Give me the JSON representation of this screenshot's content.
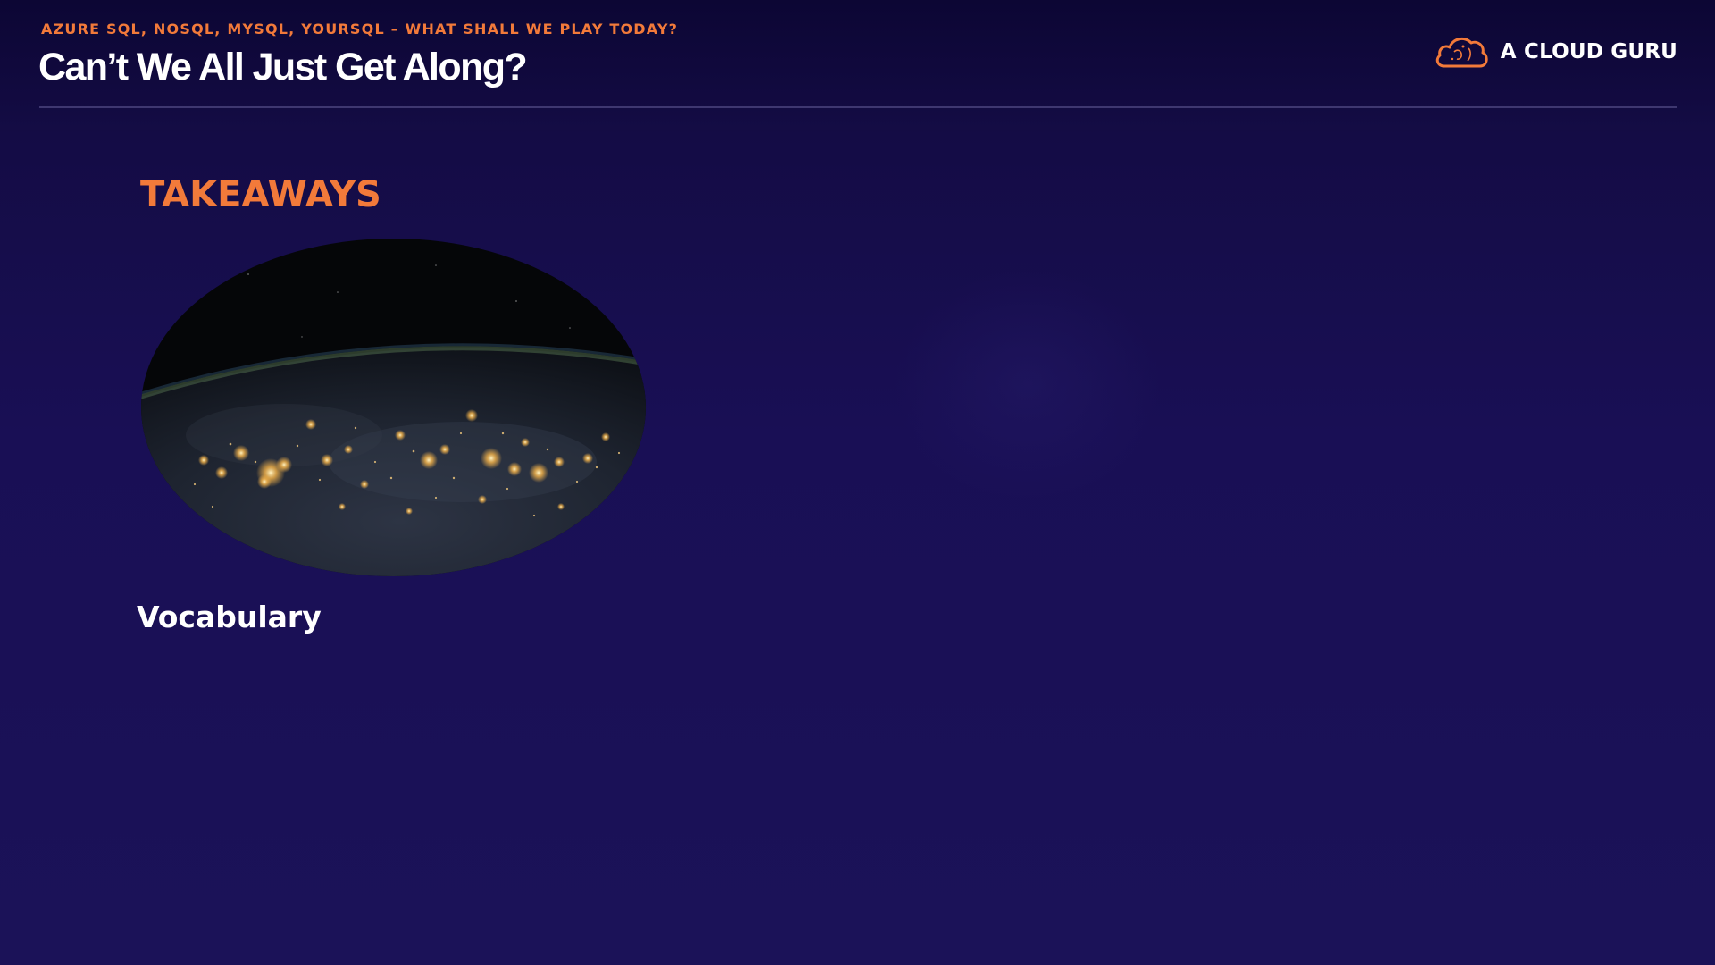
{
  "header": {
    "eyebrow": "AZURE SQL, NOSQL, MYSQL, YOURSQL – WHAT SHALL WE PLAY TODAY?",
    "title": "Can’t We All Just Get Along?"
  },
  "brand": {
    "name": "A CLOUD GURU",
    "icon": "cloud-logo-icon"
  },
  "slide": {
    "section_heading": "TAKEAWAYS",
    "image": "earth-at-night-image",
    "item_label": "Vocabulary"
  },
  "colors": {
    "accent": "#f27a3a",
    "background": "#1b1258",
    "text": "#ffffff"
  }
}
